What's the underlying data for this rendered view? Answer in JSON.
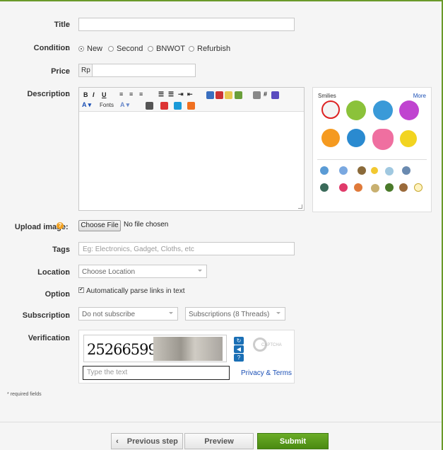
{
  "form": {
    "title": {
      "label": "Title",
      "value": ""
    },
    "condition": {
      "label": "Condition",
      "options": [
        "New",
        "Second",
        "BNWOT",
        "Refurbish"
      ],
      "selected": "New"
    },
    "price": {
      "label": "Price",
      "prefix": "Rp",
      "value": ""
    },
    "description": {
      "label": "Description",
      "toolbar": {
        "fonts_label": "Fonts"
      },
      "smilies": {
        "title": "Smilies",
        "more_label": "More"
      }
    },
    "upload": {
      "label": "Upload image",
      "button": "Choose File",
      "status": "No file chosen"
    },
    "tags": {
      "label": "Tags",
      "placeholder": "Eg: Electronics, Gadget, Cloths, etc"
    },
    "location": {
      "label": "Location",
      "selected": "Choose Location"
    },
    "option": {
      "label": "Option",
      "checkbox_label": "Automatically parse links in text",
      "checked": true
    },
    "subscription": {
      "label": "Subscription",
      "selected": "Do not subscribe",
      "threads": "Subscriptions (8 Threads)"
    },
    "verification": {
      "label": "Verification",
      "captcha_text": "25266599",
      "input_placeholder": "Type the text",
      "privacy_label": "Privacy & Terms",
      "brand": "CAPTCHA"
    },
    "required_note": "* required fields"
  },
  "actions": {
    "previous": "Previous step",
    "preview": "Preview",
    "submit": "Submit"
  },
  "colors": {
    "accent_green": "#5a9a1a",
    "link_blue": "#1a4fb5",
    "help_orange": "#f0a020"
  }
}
